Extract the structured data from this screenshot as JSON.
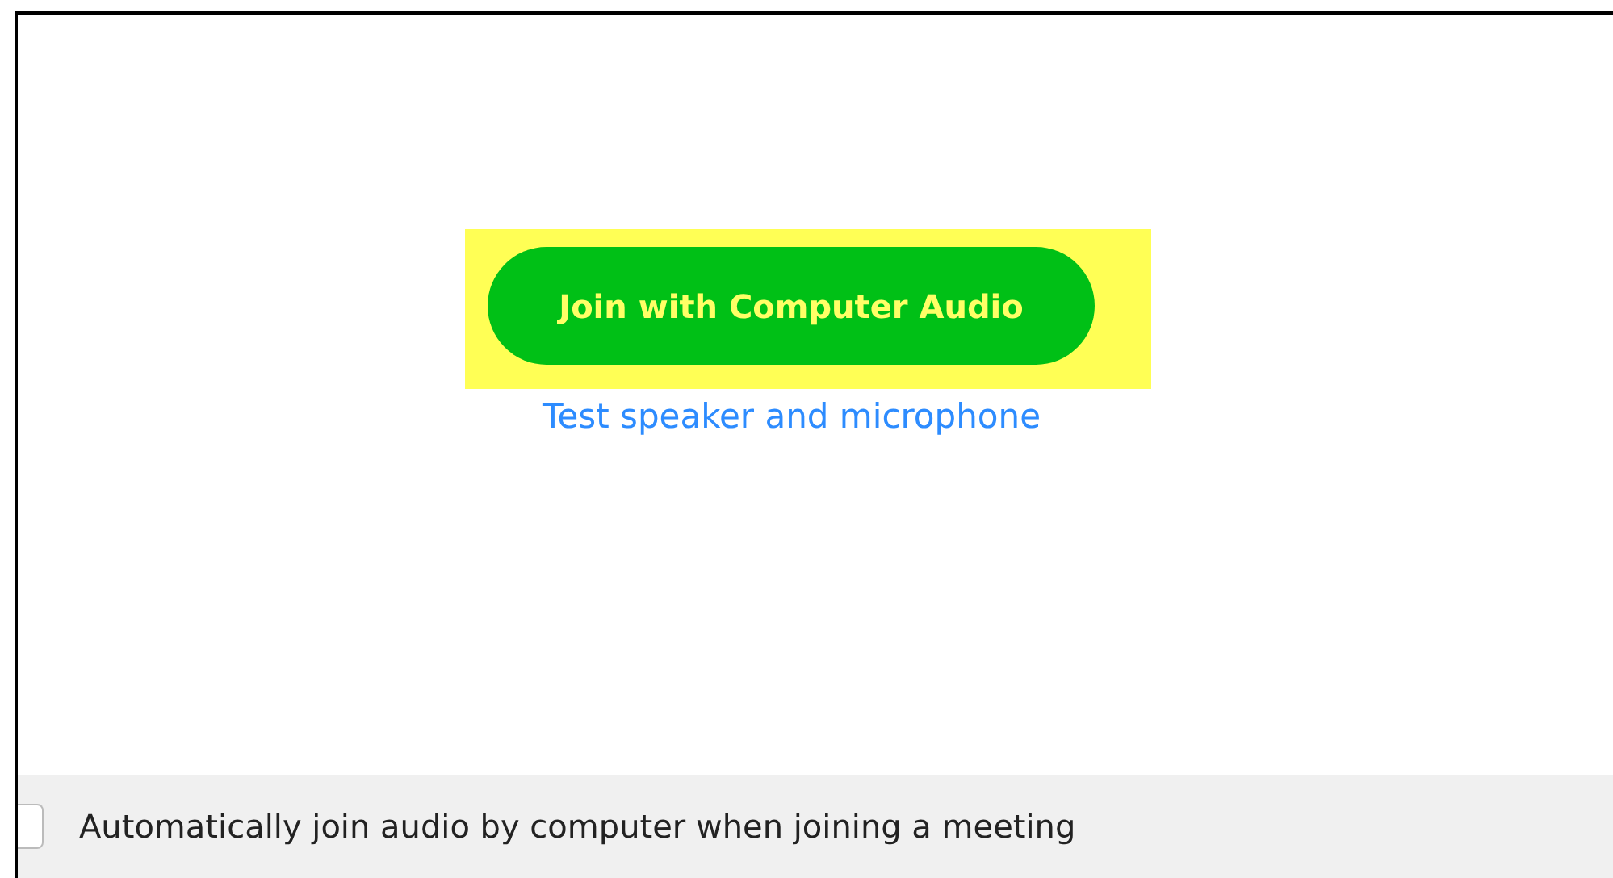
{
  "join_button": {
    "label": "Join with Computer Audio",
    "highlighted": true
  },
  "test_link": {
    "label": "Test speaker and microphone"
  },
  "auto_join": {
    "label": "Automatically join audio by computer when joining a meeting",
    "checked": false
  }
}
